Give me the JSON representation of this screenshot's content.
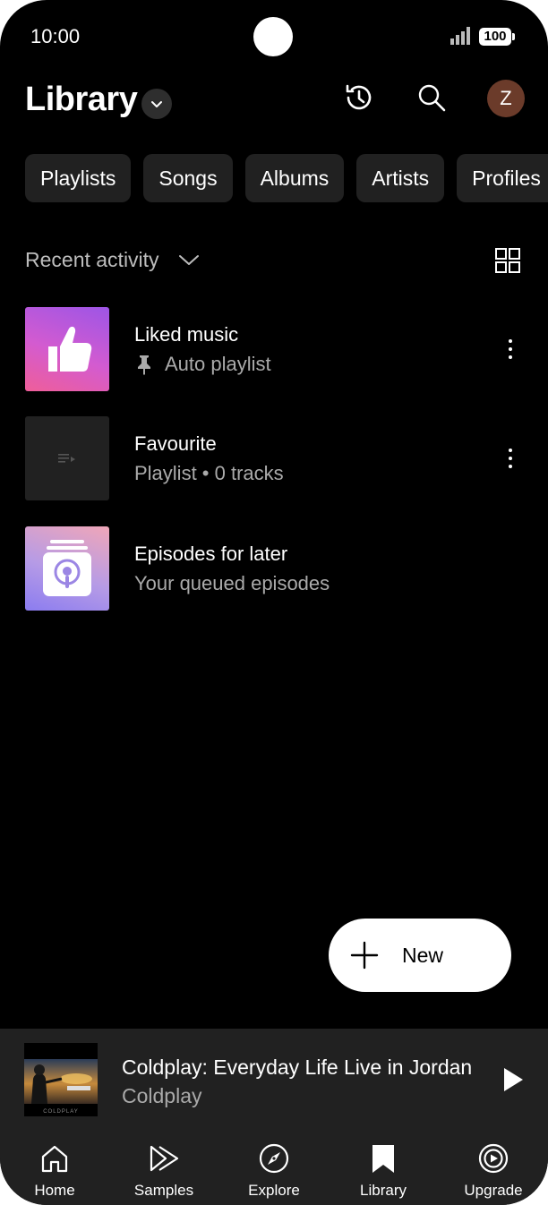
{
  "status": {
    "time": "10:00",
    "battery": "100"
  },
  "header": {
    "title": "Library",
    "avatar_letter": "Z"
  },
  "chips": [
    "Playlists",
    "Songs",
    "Albums",
    "Artists",
    "Profiles"
  ],
  "sort": {
    "label": "Recent activity"
  },
  "items": [
    {
      "title": "Liked music",
      "subtitle": "Auto playlist",
      "pinned": true
    },
    {
      "title": "Favourite",
      "subtitle": "Playlist • 0 tracks"
    },
    {
      "title": "Episodes for later",
      "subtitle": "Your queued episodes"
    }
  ],
  "fab": {
    "label": "New"
  },
  "mini_player": {
    "title": "Coldplay: Everyday Life Live in Jordan",
    "artist": "Coldplay",
    "art_text": "COLDPLAY"
  },
  "nav": [
    {
      "label": "Home",
      "icon": "home-icon"
    },
    {
      "label": "Samples",
      "icon": "samples-icon"
    },
    {
      "label": "Explore",
      "icon": "explore-icon"
    },
    {
      "label": "Library",
      "icon": "library-icon"
    },
    {
      "label": "Upgrade",
      "icon": "upgrade-icon"
    }
  ],
  "colors": {
    "background": "#000000",
    "surface": "#212121",
    "chip": "#212121",
    "text_secondary": "#aaaaaa",
    "avatar": "#6b3b2a"
  }
}
